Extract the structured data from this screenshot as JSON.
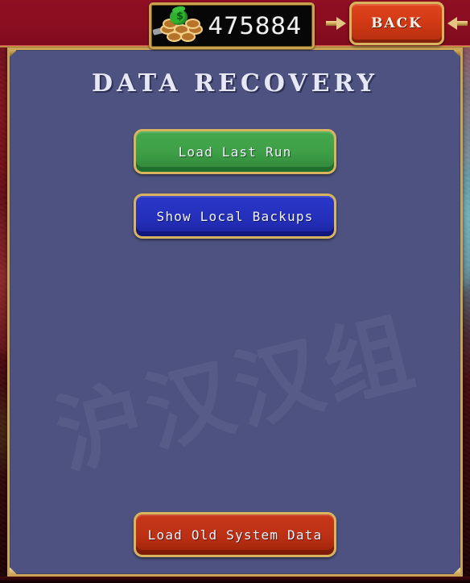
{
  "topbar": {
    "money": {
      "icon": "coin-pile-icon",
      "value": "475884"
    },
    "back_button": {
      "label": "BACK",
      "left_arrow_icon": "arrow-right-icon",
      "right_arrow_icon": "arrow-left-icon"
    }
  },
  "panel": {
    "title": "DATA RECOVERY",
    "watermark": "沪汉汉组",
    "buttons": [
      {
        "label": "Load Last Run",
        "color": "#3d9e46"
      },
      {
        "label": "Show Local Backups",
        "color": "#2430bb"
      },
      {
        "label": "Load Old System Data",
        "color": "#bb3014"
      }
    ]
  },
  "colors": {
    "panel_background": "#4e5280",
    "panel_border": "#caa355",
    "topbar_background": "#8a0d20",
    "gold": "#d8b45e",
    "text_light": "#f2f4ff"
  }
}
